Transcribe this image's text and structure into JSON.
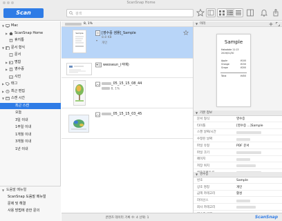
{
  "window": {
    "title": "ScanSnap Home"
  },
  "toolbar": {
    "scan_label": "Scan",
    "search_placeholder": "검색"
  },
  "sidebar": {
    "items": [
      {
        "label": "Mac",
        "indent": 0,
        "tri": "▼",
        "icon": "computer-icon"
      },
      {
        "label": "ScanSnap Home",
        "indent": 1,
        "tri": "▶",
        "icon": "home-icon"
      },
      {
        "label": "휴지통",
        "indent": 1,
        "tri": "",
        "icon": "trash-icon"
      },
      {
        "label": "문서 형식",
        "indent": 0,
        "tri": "▼",
        "icon": "document-types-icon"
      },
      {
        "label": "문서",
        "indent": 1,
        "tri": "",
        "icon": "document-icon"
      },
      {
        "label": "명함",
        "indent": 1,
        "tri": "▶",
        "icon": "business-card-icon"
      },
      {
        "label": "영수증",
        "indent": 1,
        "tri": "▶",
        "icon": "receipt-icon"
      },
      {
        "label": "사진",
        "indent": 1,
        "tri": "",
        "icon": "photo-icon"
      },
      {
        "label": "태그",
        "indent": 0,
        "tri": "▶",
        "icon": "tag-icon"
      },
      {
        "label": "최근 편집",
        "indent": 0,
        "tri": "▶",
        "icon": "clock-icon"
      },
      {
        "label": "스캔 시간",
        "indent": 0,
        "tri": "▼",
        "icon": "calendar-icon"
      },
      {
        "label": "최근 스캔",
        "indent": 1,
        "tri": "",
        "icon": "",
        "selected": true
      },
      {
        "label": "오늘",
        "indent": 1,
        "tri": "",
        "icon": ""
      },
      {
        "label": "3일 이내",
        "indent": 1,
        "tri": "",
        "icon": ""
      },
      {
        "label": "1주일 이내",
        "indent": 1,
        "tri": "",
        "icon": ""
      },
      {
        "label": "1개월 이내",
        "indent": 1,
        "tri": "",
        "icon": ""
      },
      {
        "label": "3개월 이내",
        "indent": 1,
        "tri": "",
        "icon": ""
      },
      {
        "label": "1년 이내",
        "indent": 1,
        "tri": "",
        "icon": ""
      }
    ],
    "help": {
      "header": "도움말 메뉴얼",
      "items": [
        "ScanSnap 도움말 메뉴얼",
        "문제 및 해결",
        "사용 방법에 관한 문의"
      ]
    }
  },
  "list": {
    "header_suffix": "8, 1%",
    "items": [
      {
        "title": "[영수증 샘플]_Sample",
        "sub1": "8.8 KB",
        "sub2": "개인"
      },
      {
        "title": "weoseun_(석예)",
        "sub1": "",
        "sub2": ""
      },
      {
        "title_suffix": "_05_15_15_08_44",
        "sub1_suffix": "8, 1%"
      },
      {
        "title_suffix": "_05_15_15_03_45",
        "sub1_suffix": ""
      }
    ]
  },
  "status": {
    "text": "콘텐츠 데이터 기록 수: 4   선택: 1",
    "brand": "ScanSnap"
  },
  "preview": {
    "header": "미리",
    "receipt": {
      "title": "Sample",
      "lines": [
        "Hakodate 11:13",
        "2019/01/30",
        "",
        "Apple",
        "Orange",
        "Grape",
        "",
        "Total"
      ],
      "values": [
        "",
        "",
        "",
        "¥100",
        "¥150",
        "¥200",
        "",
        "¥450"
      ]
    }
  },
  "props": {
    "header": "기본 정보",
    "rows": [
      {
        "k": "문서 형식",
        "v": "영수증"
      },
      {
        "k": "타이틀",
        "v": "[영수증 ...]Sample"
      },
      {
        "k": "스캔 날짜/시간",
        "v": ""
      },
      {
        "k": "수정된 날짜",
        "v": ""
      },
      {
        "k": "파일 유형",
        "v": "PDF 문서"
      },
      {
        "k": "파일 크기",
        "v": ""
      },
      {
        "k": "페이지",
        "v": ""
      },
      {
        "k": "저장 위치",
        "v": ""
      },
      {
        "k": "애플리케이션",
        "v": ""
      }
    ]
  },
  "receipt_props": {
    "header": "영수증",
    "rows": [
      {
        "k": "번호",
        "v": "Sample"
      },
      {
        "k": "상호 명칭",
        "v": "개인"
      },
      {
        "k": "금액 카테고리",
        "v": "활성"
      },
      {
        "k": "라이선스",
        "v": ""
      },
      {
        "k": "회사 카테고리",
        "v": ""
      },
      {
        "k": "영수증 금액",
        "v": ""
      }
    ]
  },
  "colors": {
    "accent": "#2f7ce6",
    "selection": "#b8d5f8"
  }
}
